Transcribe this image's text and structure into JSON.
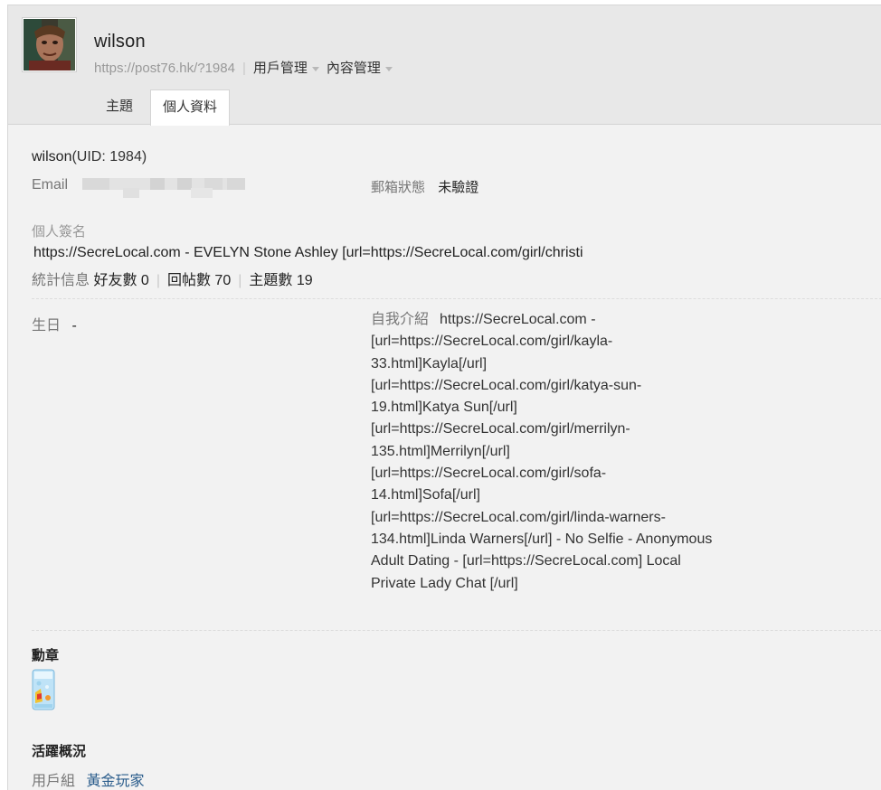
{
  "user": {
    "name": "wilson",
    "url": "https://post76.hk/?1984",
    "menus": [
      "用戶管理",
      "內容管理"
    ]
  },
  "tabs": [
    "主題",
    "個人資料"
  ],
  "profile": {
    "uid": "(UID: 1984)",
    "email_label": "Email",
    "mail_status_label": "郵箱狀態",
    "mail_status_value": "未驗證",
    "signature_label": "個人簽名",
    "signature": "https://SecreLocal.com - EVELYN Stone Ashley [url=https://SecreLocal.com/girl/christi",
    "stats_label": "統計信息",
    "stats": {
      "friends": "好友數 0",
      "replies": "回帖數 70",
      "threads": "主題數 19"
    },
    "birthday_label": "生日",
    "birthday_value": "-",
    "intro_label": "自我介紹",
    "intro_text": "https://SecreLocal.com - [url=https://SecreLocal.com/girl/kayla-33.html]Kayla[/url] [url=https://SecreLocal.com/girl/katya-sun-19.html]Katya Sun[/url] [url=https://SecreLocal.com/girl/merrilyn-135.html]Merrilyn[/url] [url=https://SecreLocal.com/girl/sofa-14.html]Sofa[/url] [url=https://SecreLocal.com/girl/linda-warners-134.html]Linda Warners[/url] - No Selfie - Anonymous Adult Dating - [url=https://SecreLocal.com] Local Private Lady Chat [/url]",
    "medals_title": "勳章",
    "activity_title": "活躍概況",
    "usergroup_label": "用戶組",
    "usergroup_value": "黃金玩家"
  },
  "colors": {
    "background": "#f2f2f2",
    "header": "#e8e8e8",
    "link": "#2b5d8c"
  }
}
